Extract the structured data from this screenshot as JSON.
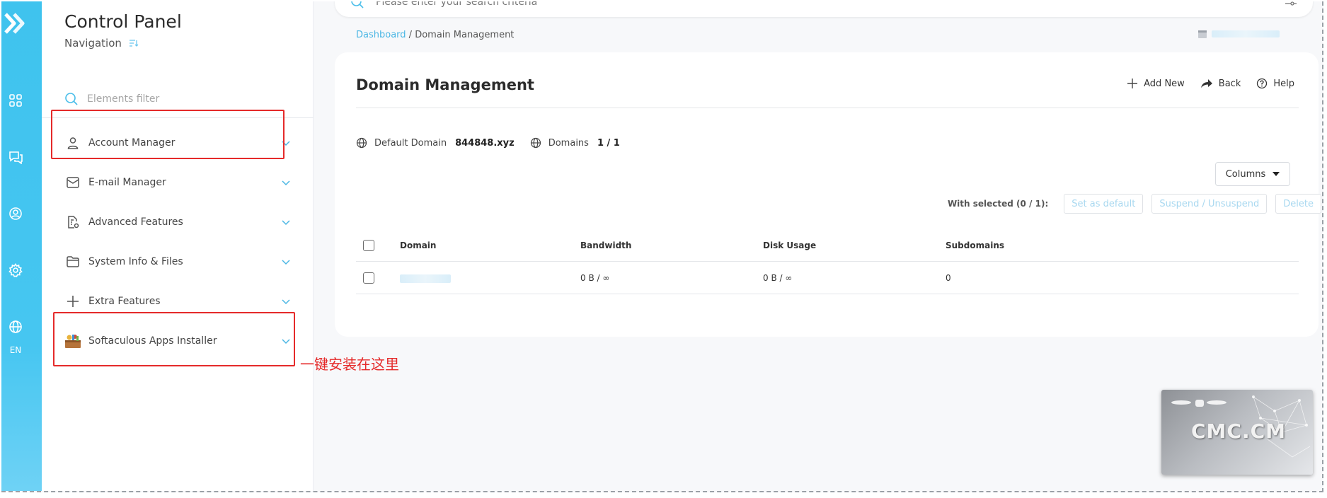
{
  "rail": {
    "lang": "EN",
    "accent": "#46c6f1",
    "icons": [
      "logo-icon",
      "grid-icon",
      "chat-icon",
      "user-circle-icon",
      "gear-icon",
      "globe-icon"
    ]
  },
  "nav": {
    "title": "Control Panel",
    "subtitle": "Navigation",
    "filter_placeholder": "Elements filter",
    "items": [
      {
        "label": "Account Manager",
        "icon": "user-icon"
      },
      {
        "label": "E-mail Manager",
        "icon": "mail-icon"
      },
      {
        "label": "Advanced Features",
        "icon": "document-gear-icon"
      },
      {
        "label": "System Info & Files",
        "icon": "folder-icon"
      },
      {
        "label": "Extra Features",
        "icon": "plus-icon"
      },
      {
        "label": "Softaculous Apps Installer",
        "icon": "softaculous-icon"
      }
    ]
  },
  "annotation": "一键安装在这里",
  "search": {
    "placeholder": "Please enter your search criteria"
  },
  "breadcrumb": {
    "home": "Dashboard",
    "separator": " / ",
    "current": "Domain Management"
  },
  "page": {
    "title": "Domain Management",
    "actions": {
      "add": "Add New",
      "back": "Back",
      "help": "Help"
    },
    "meta": {
      "default_domain_label": "Default Domain",
      "default_domain_value": "844848.xyz",
      "domains_label": "Domains",
      "domains_value": "1 / 1"
    },
    "columns_button": "Columns",
    "bulk": {
      "label": "With selected (0 / 1):",
      "set_default": "Set as default",
      "suspend": "Suspend / Unsuspend",
      "delete": "Delete"
    },
    "table": {
      "headers": {
        "domain": "Domain",
        "bandwidth": "Bandwidth",
        "disk": "Disk Usage",
        "subdomains": "Subdomains"
      },
      "rows": [
        {
          "domain": "",
          "bandwidth": "0 B / ∞",
          "disk": "0 B / ∞",
          "subdomains": "0"
        }
      ]
    }
  },
  "watermark": "CMC.CM"
}
